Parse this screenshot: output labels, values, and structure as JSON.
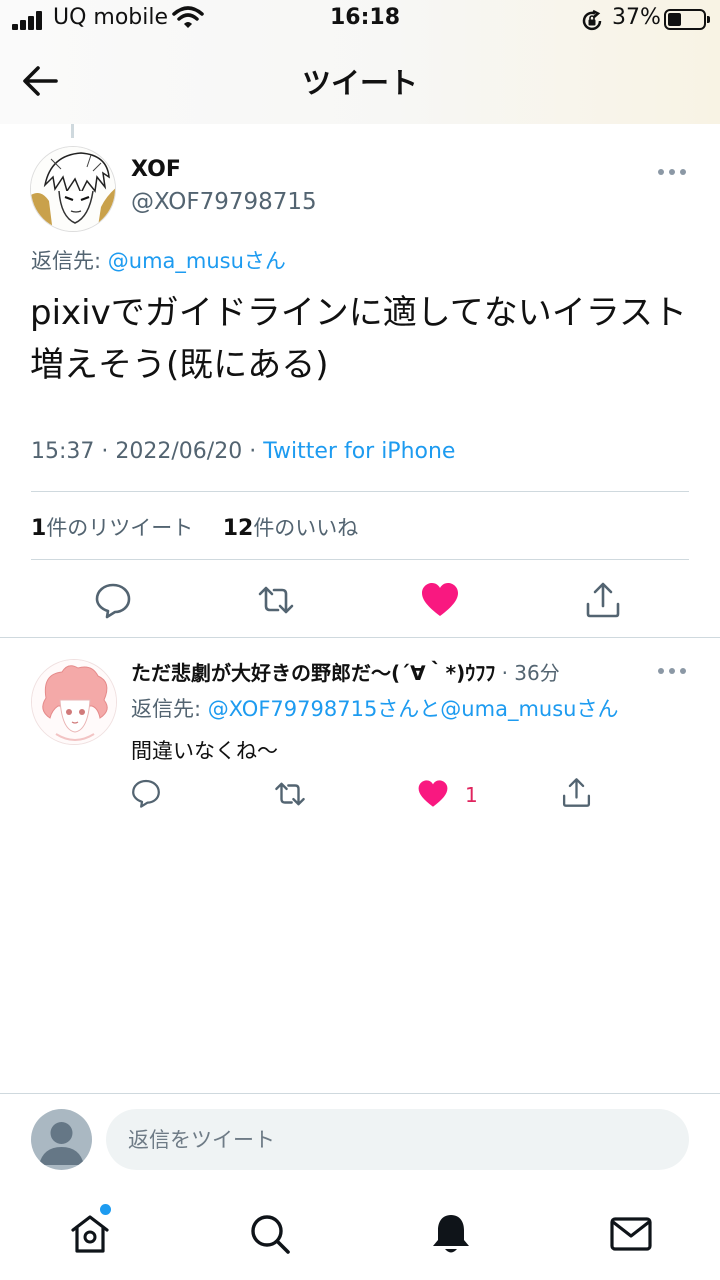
{
  "status_bar": {
    "carrier": "UQ mobile",
    "time": "16:18",
    "battery_percent": "37%",
    "battery_level": 0.37,
    "icons": [
      "signal-icon",
      "wifi-icon",
      "rotation-lock-icon",
      "battery-icon"
    ]
  },
  "header": {
    "title": "ツイート",
    "back_icon": "arrow-left-icon"
  },
  "tweet": {
    "name": "XOF",
    "handle": "@XOF79798715",
    "reply_prefix": "返信先: ",
    "reply_to": "@uma_musuさん",
    "text": "pixivでガイドラインに適してないイラスト増えそう(既にある)",
    "time": "15:37",
    "date": "2022/06/20",
    "source": "Twitter for iPhone",
    "retweet_count": "1",
    "retweet_label": "件のリツイート",
    "like_count": "12",
    "like_label": "件のいいね"
  },
  "reply": {
    "name": "ただ悲劇が大好きの野郎だ〜(´∀｀*)ｳﾌﾌ",
    "time": "36分",
    "reply_prefix": "返信先: ",
    "reply_to": "@XOF79798715さんと@uma_musuさん",
    "text": "間違いなくね〜",
    "like_count": "1"
  },
  "compose": {
    "placeholder": "返信をツイート"
  },
  "tabs": [
    "home-icon",
    "search-icon",
    "notifications-bell-icon",
    "messages-envelope-icon"
  ],
  "colors": {
    "accent": "#1d9bf0",
    "like": "#f91880",
    "icon": "#536471",
    "text": "#0f1419"
  }
}
